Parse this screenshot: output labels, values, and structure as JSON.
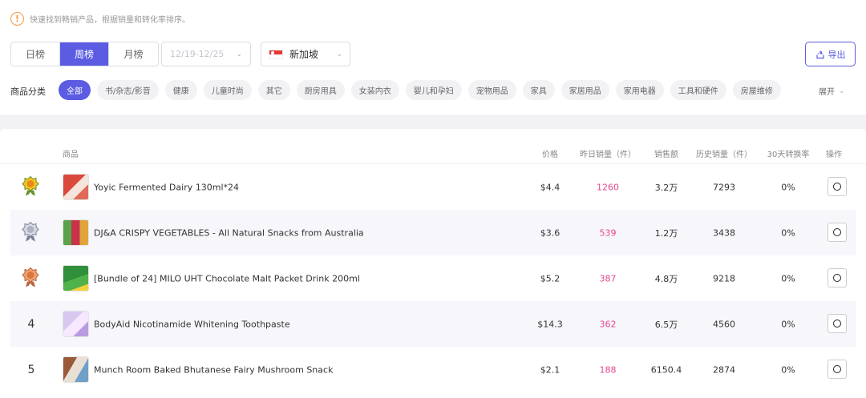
{
  "tip": {
    "text": "快速找到畅销产品，根据销量和转化率排序。"
  },
  "period_tabs": [
    {
      "label": "日榜",
      "active": false
    },
    {
      "label": "周榜",
      "active": true
    },
    {
      "label": "月榜",
      "active": false
    }
  ],
  "date_range": {
    "value": "12/19-12/25"
  },
  "country": {
    "value": "新加坡",
    "flag_icon": "singapore-flag-icon"
  },
  "export": {
    "label": "导出",
    "icon": "export-icon"
  },
  "categories": {
    "label": "商品分类",
    "items": [
      "全部",
      "书/杂志/影音",
      "健康",
      "儿童时尚",
      "其它",
      "厨房用具",
      "女装内衣",
      "婴儿和孕妇",
      "宠物用品",
      "家具",
      "家居用品",
      "家用电器",
      "工具和硬件",
      "房屋维修"
    ],
    "active_index": 0,
    "expand_label": "展开"
  },
  "table": {
    "headers": {
      "product": "商品",
      "price": "价格",
      "yesterday_sales": "昨日销量（件）",
      "revenue": "销售额",
      "history_sales": "历史销量（件）",
      "conversion": "30天转换率",
      "action": "操作"
    },
    "rows": [
      {
        "rank": "1",
        "medal": "gold",
        "name": "Yoyic Fermented Dairy 130ml*24",
        "price": "$4.4",
        "yesterday": "1260",
        "revenue": "3.2万",
        "history": "7293",
        "conversion": "0%"
      },
      {
        "rank": "2",
        "medal": "silver",
        "name": "DJ&A CRISPY VEGETABLES - All Natural Snacks from Australia",
        "price": "$3.6",
        "yesterday": "539",
        "revenue": "1.2万",
        "history": "3438",
        "conversion": "0%"
      },
      {
        "rank": "3",
        "medal": "bronze",
        "name": "[Bundle of 24] MILO UHT Chocolate Malt Packet Drink 200ml",
        "price": "$5.2",
        "yesterday": "387",
        "revenue": "4.8万",
        "history": "9218",
        "conversion": "0%"
      },
      {
        "rank": "4",
        "medal": "",
        "name": "BodyAid Nicotinamide Whitening Toothpaste",
        "price": "$14.3",
        "yesterday": "362",
        "revenue": "6.5万",
        "history": "4560",
        "conversion": "0%"
      },
      {
        "rank": "5",
        "medal": "",
        "name": "Munch Room Baked Bhutanese Fairy Mushroom Snack",
        "price": "$2.1",
        "yesterday": "188",
        "revenue": "6150.4",
        "history": "2874",
        "conversion": "0%"
      }
    ]
  },
  "colors": {
    "accent": "#5b5ce2",
    "sales_highlight": "#e6478f",
    "tip_icon": "#f29a3f"
  }
}
